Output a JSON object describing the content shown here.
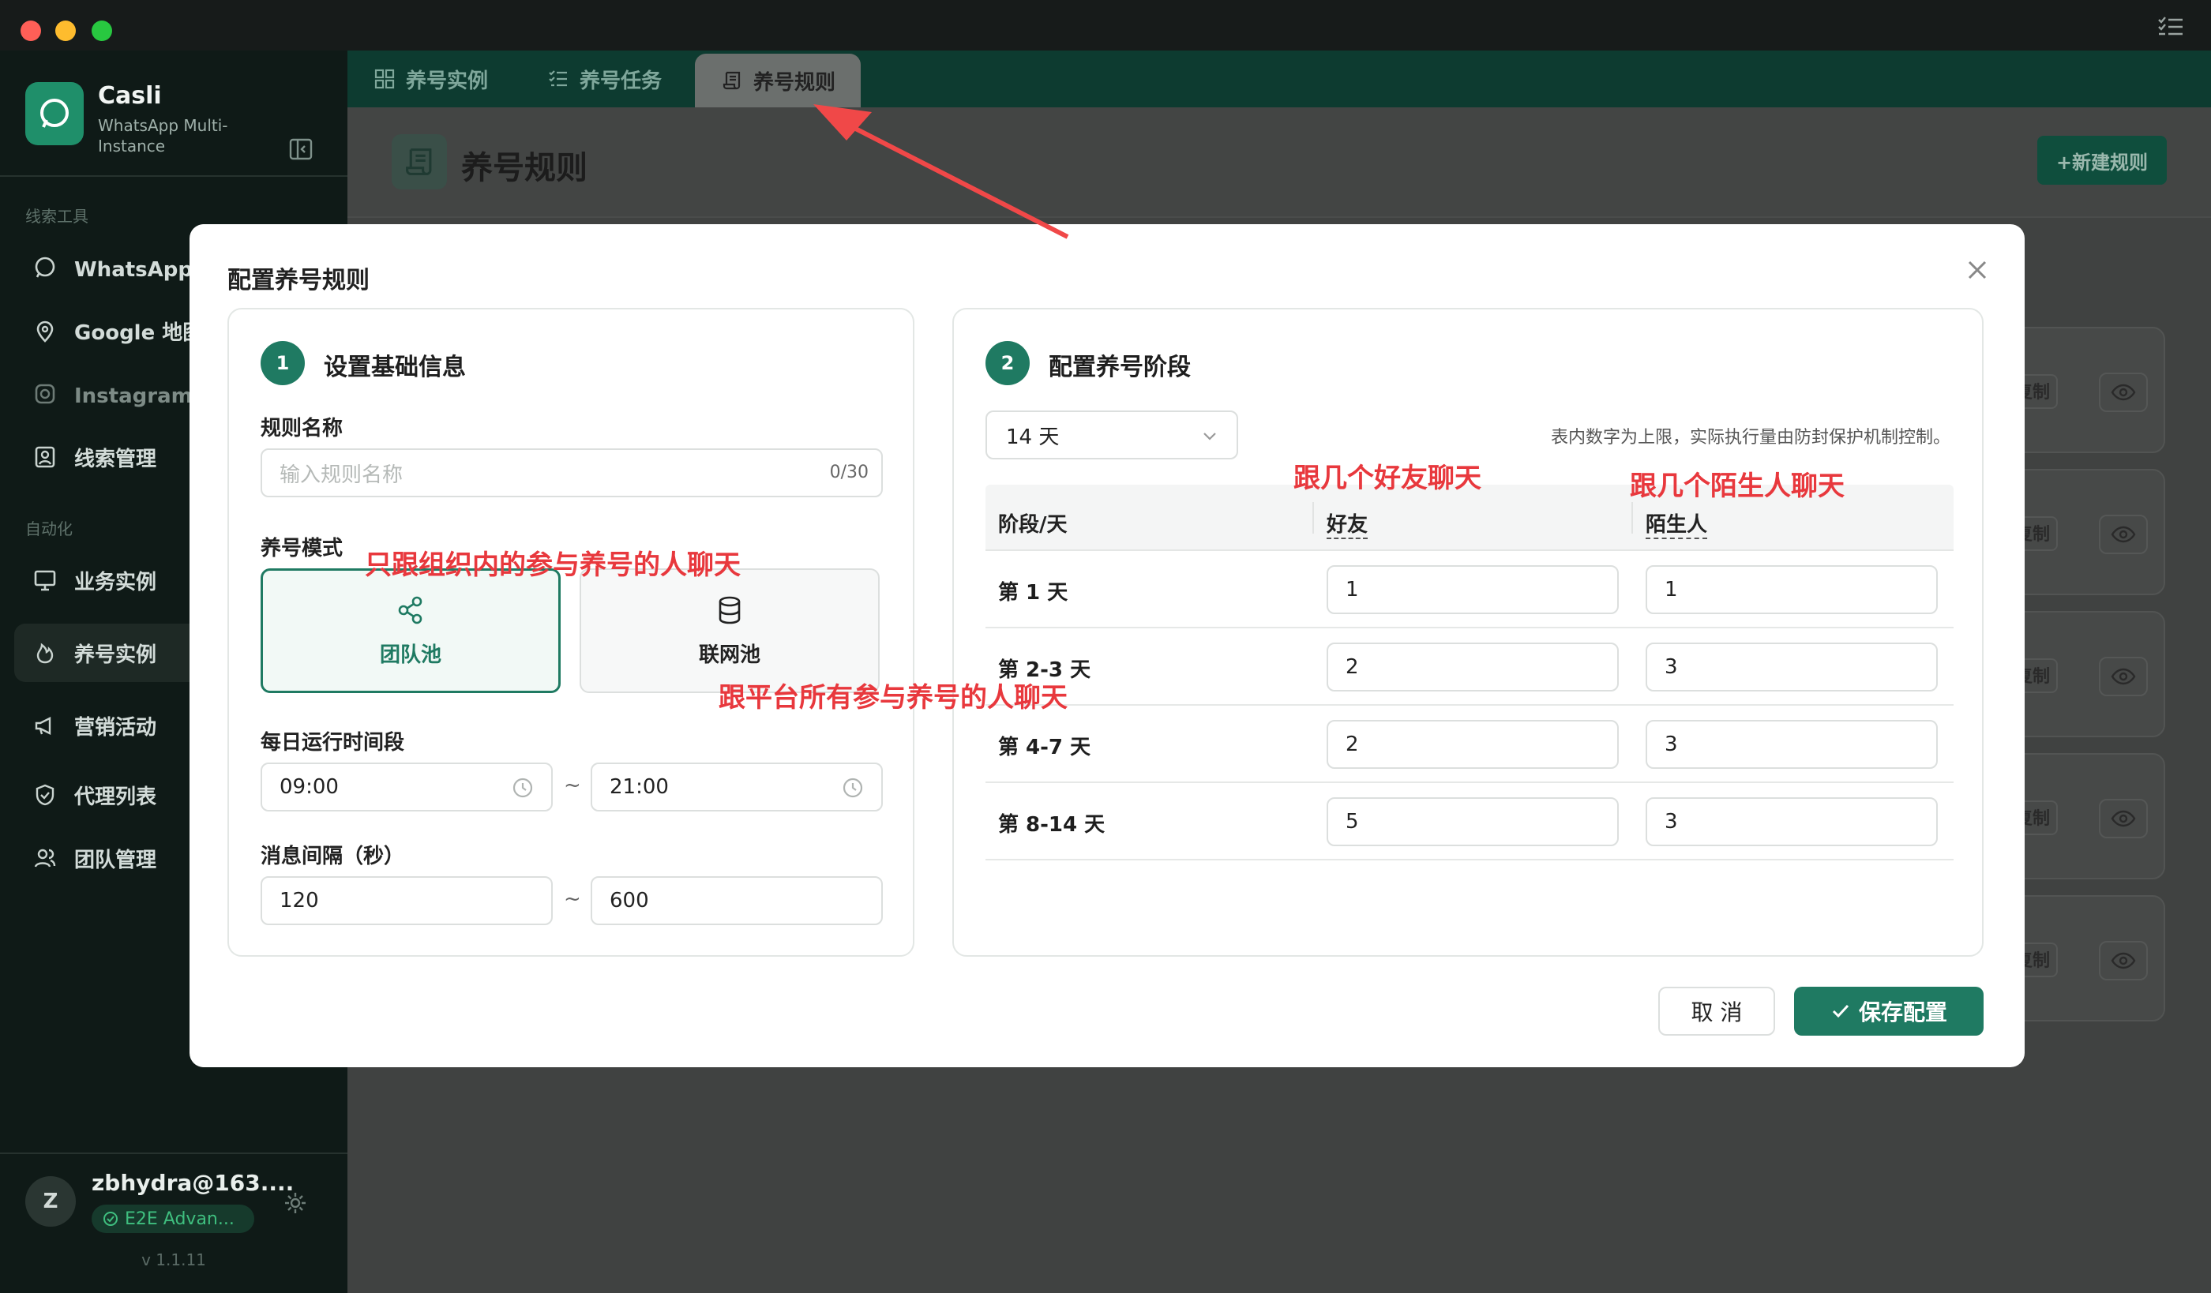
{
  "app": {
    "name": "Casli",
    "subtitle": "WhatsApp Multi-Instance",
    "version": "v 1.1.11"
  },
  "sidebar": {
    "section1": "线索工具",
    "section2": "自动化",
    "items": [
      {
        "label": "WhatsApp 筛",
        "icon": "chat-bubble-icon"
      },
      {
        "label": "Google 地图",
        "icon": "map-pin-icon"
      },
      {
        "label": "Instagram 筛",
        "icon": "instagram-icon"
      },
      {
        "label": "线索管理",
        "icon": "contact-card-icon"
      },
      {
        "label": "业务实例",
        "icon": "monitor-icon"
      },
      {
        "label": "养号实例",
        "icon": "flame-icon"
      },
      {
        "label": "营销活动",
        "icon": "megaphone-icon"
      },
      {
        "label": "代理列表",
        "icon": "shield-icon"
      },
      {
        "label": "团队管理",
        "icon": "users-icon"
      }
    ],
    "user": {
      "initial": "Z",
      "email": "zbhydra@163....",
      "badge": "E2E Advan..."
    }
  },
  "tabs": [
    {
      "label": "养号实例",
      "icon": "grid-icon"
    },
    {
      "label": "养号任务",
      "icon": "checklist-icon"
    },
    {
      "label": "养号规则",
      "icon": "scroll-icon"
    }
  ],
  "page": {
    "title": "养号规则",
    "new_button": "+新建规则",
    "card_copy": "复制"
  },
  "modal": {
    "title": "配置养号规则",
    "step1": {
      "num": "1",
      "title": "设置基础信息",
      "rule_name_label": "规则名称",
      "rule_name_placeholder": "输入规则名称",
      "rule_name_counter": "0/30",
      "mode_label": "养号模式",
      "mode_team": "团队池",
      "mode_net": "联网池",
      "time_label": "每日运行时间段",
      "time_start": "09:00",
      "time_end": "21:00",
      "interval_label": "消息间隔（秒）",
      "interval_min": "120",
      "interval_max": "600",
      "tilde": "~"
    },
    "step2": {
      "num": "2",
      "title": "配置养号阶段",
      "days_selected": "14 天",
      "hint": "表内数字为上限，实际执行量由防封保护机制控制。",
      "col_stage": "阶段/天",
      "col_friends": "好友",
      "col_strangers": "陌生人",
      "rows": [
        {
          "day": "第 1 天",
          "friends": "1",
          "strangers": "1"
        },
        {
          "day": "第 2-3 天",
          "friends": "2",
          "strangers": "3"
        },
        {
          "day": "第 4-7 天",
          "friends": "2",
          "strangers": "3"
        },
        {
          "day": "第 8-14 天",
          "friends": "5",
          "strangers": "3"
        }
      ]
    },
    "cancel": "取 消",
    "save": "保存配置"
  },
  "annotations": {
    "friends": "跟几个好友聊天",
    "strangers": "跟几个陌生人聊天",
    "team_pool": "只跟组织内的参与养号的人聊天",
    "net_pool": "跟平台所有参与养号的人聊天"
  },
  "colors": {
    "accent": "#1f7a62",
    "annotation": "#e8383d"
  }
}
